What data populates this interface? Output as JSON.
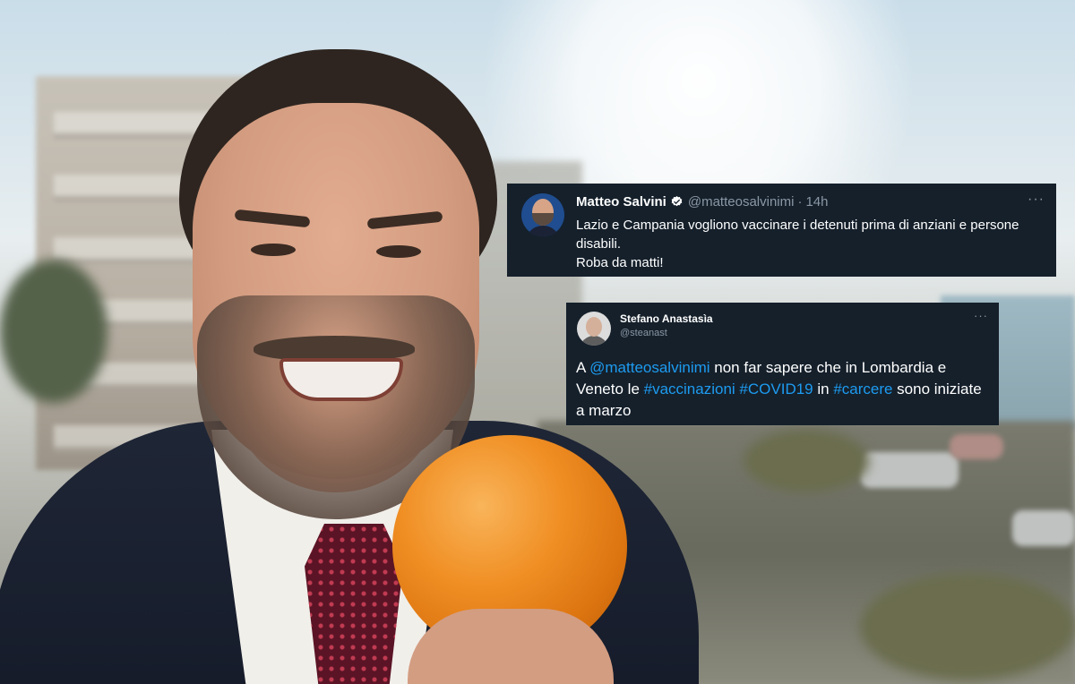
{
  "tweet1": {
    "name": "Matteo Salvini",
    "handle": "@matteosalvinimi",
    "separator": "·",
    "time": "14h",
    "more": "···",
    "line1": "Lazio e Campania vogliono vaccinare i detenuti prima di anziani e persone disabili.",
    "line2": "Roba da matti!"
  },
  "tweet2": {
    "name": "Stefano Anastasìa",
    "handle": "@steanast",
    "more": "···",
    "text": {
      "t1": "A ",
      "mention": "@matteosalvinimi",
      "t2": " non far sapere che in Lombardia e Veneto le ",
      "hashtag1": "#vaccinazioni",
      "t3": " ",
      "hashtag2": "#COVID19",
      "t4": " in ",
      "hashtag3": "#carcere",
      "t5": " sono iniziate a marzo"
    }
  },
  "colors": {
    "card_bg": "#15202b",
    "link": "#1d9bf0",
    "muted": "#8b98a5",
    "verified": "#ffffff"
  },
  "icons": {
    "verified": "verified-badge-icon",
    "more": "more-options-icon"
  }
}
